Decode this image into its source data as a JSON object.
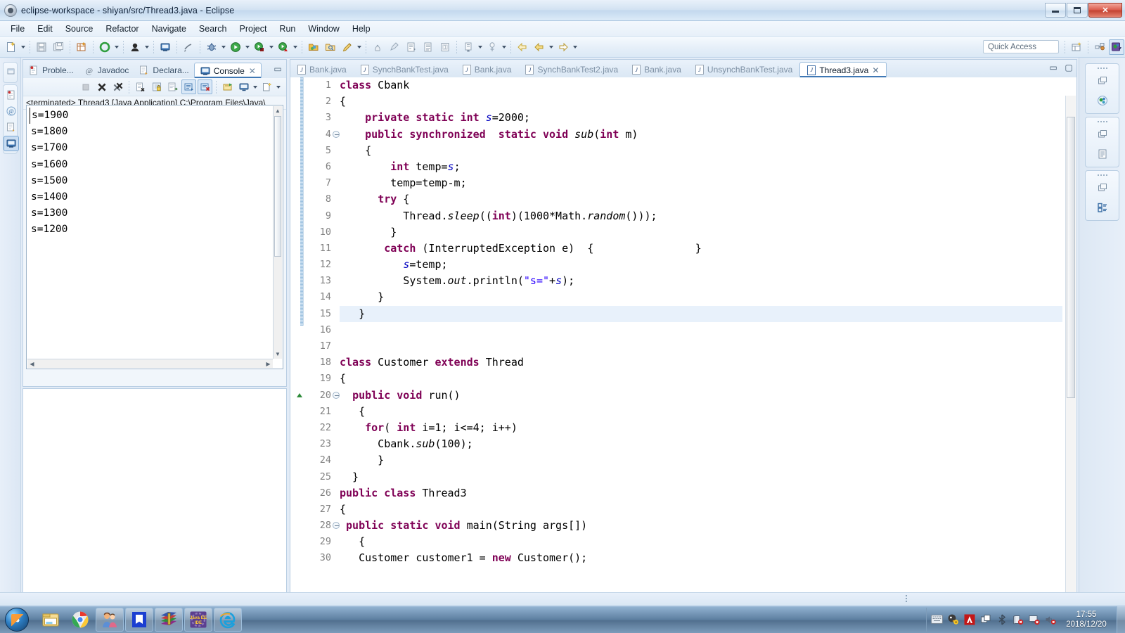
{
  "window": {
    "title": "eclipse-workspace - shiyan/src/Thread3.java - Eclipse",
    "icon": "eclipse-icon",
    "minimize_label": "",
    "maximize_label": "",
    "close_label": "✕"
  },
  "menubar": {
    "items": [
      "File",
      "Edit",
      "Source",
      "Refactor",
      "Navigate",
      "Search",
      "Project",
      "Run",
      "Window",
      "Help"
    ]
  },
  "toolbar": {
    "quick_access_placeholder": "Quick Access",
    "buttons": [
      {
        "name": "new-wizard-icon",
        "dropdown": true
      },
      {
        "name": "save-icon",
        "dropdown": false
      },
      {
        "name": "save-all-icon",
        "dropdown": false
      },
      {
        "name": "new-java-package-icon",
        "dropdown": false
      },
      {
        "name": "refresh-icon",
        "dropdown": true
      },
      {
        "name": "new-java-class-icon",
        "dropdown": true
      },
      {
        "name": "open-type-icon",
        "dropdown": false
      },
      {
        "name": "skip-breakpoints-icon",
        "dropdown": false
      },
      {
        "name": "debug-icon",
        "dropdown": true
      },
      {
        "name": "run-icon",
        "dropdown": true
      },
      {
        "name": "run-coverage-icon",
        "dropdown": true
      },
      {
        "name": "external-tools-icon",
        "dropdown": true
      },
      {
        "name": "open-task-icon",
        "dropdown": false
      },
      {
        "name": "search-folder-icon",
        "dropdown": false
      },
      {
        "name": "edit-pencil-icon",
        "dropdown": true
      },
      {
        "name": "profile-icon",
        "dropdown": false
      },
      {
        "name": "annotation-icon",
        "dropdown": false
      },
      {
        "name": "next-annotation-icon",
        "dropdown": false
      },
      {
        "name": "previous-edit-icon",
        "dropdown": false
      },
      {
        "name": "last-edit-location-icon",
        "dropdown": false
      },
      {
        "name": "toggle-mark-occurrences-icon",
        "dropdown": false
      },
      {
        "name": "back-icon",
        "dropdown": true
      },
      {
        "name": "forward-icon",
        "dropdown": true
      },
      {
        "name": "next-icon",
        "dropdown": true
      }
    ],
    "perspective_buttons": [
      {
        "name": "open-perspective-icon"
      },
      {
        "name": "java-perspective-icon"
      },
      {
        "name": "java-ee-perspective-icon"
      }
    ]
  },
  "fastview_left": {
    "items": [
      {
        "name": "minimize-icon"
      },
      {
        "name": "problems-view-icon"
      },
      {
        "name": "javadoc-view-icon"
      },
      {
        "name": "declaration-view-icon"
      },
      {
        "name": "console-view-icon",
        "active": true
      }
    ]
  },
  "console_panel": {
    "tabs": [
      {
        "label": "Proble...",
        "icon": "problems-icon",
        "active": false
      },
      {
        "label": "Javadoc",
        "icon": "javadoc-icon",
        "active": false
      },
      {
        "label": "Declara...",
        "icon": "declaration-icon",
        "active": false
      },
      {
        "label": "Console",
        "icon": "console-icon",
        "active": true,
        "close": "✕"
      }
    ],
    "minimize_glyph": "▭",
    "toolbar_buttons": [
      {
        "name": "terminate-disabled-icon",
        "toggled": false
      },
      {
        "name": "terminate-icon",
        "toggled": false
      },
      {
        "name": "remove-all-terminated-icon",
        "toggled": false
      },
      {
        "name": "clear-console-icon",
        "toggled": false
      },
      {
        "name": "lock-scroll-icon",
        "toggled": false
      },
      {
        "name": "word-wrap-icon",
        "toggled": false
      },
      {
        "name": "scroll-lock-icon",
        "toggled": true
      },
      {
        "name": "pin-console-icon",
        "toggled": true
      },
      {
        "name": "display-selected-console-icon",
        "toggled": false
      },
      {
        "name": "open-console-icon",
        "toggled": false
      },
      {
        "name": "new-console-view-icon",
        "toggled": false
      }
    ],
    "process_label": "<terminated> Thread3 [Java Application] C:\\Program Files\\Java\\",
    "output_lines": [
      "s=1900",
      "s=1800",
      "s=1700",
      "s=1600",
      "s=1500",
      "s=1400",
      "s=1300",
      "s=1200"
    ]
  },
  "editor": {
    "tabs": [
      {
        "label": "Bank.java",
        "active": false
      },
      {
        "label": "SynchBankTest.java",
        "active": false
      },
      {
        "label": "Bank.java",
        "active": false
      },
      {
        "label": "SynchBankTest2.java",
        "active": false
      },
      {
        "label": "Bank.java",
        "active": false
      },
      {
        "label": "UnsynchBankTest.java",
        "active": false
      },
      {
        "label": "Thread3.java",
        "active": true,
        "close": "✕"
      }
    ],
    "minimize_glyph": "▭",
    "maximize_glyph": "▢",
    "highlighted_line": 15,
    "folded_lines": [
      4,
      20,
      28
    ],
    "marker_lines": [
      20
    ],
    "lines": [
      {
        "n": 1,
        "text": "class Cbank"
      },
      {
        "n": 2,
        "text": "{"
      },
      {
        "n": 3,
        "text": "    private static int s=2000;"
      },
      {
        "n": 4,
        "text": "    public synchronized  static void sub(int m)"
      },
      {
        "n": 5,
        "text": "    {"
      },
      {
        "n": 6,
        "text": "        int temp=s;"
      },
      {
        "n": 7,
        "text": "        temp=temp-m;"
      },
      {
        "n": 8,
        "text": "      try {"
      },
      {
        "n": 9,
        "text": "          Thread.sleep((int)(1000*Math.random()));"
      },
      {
        "n": 10,
        "text": "        }"
      },
      {
        "n": 11,
        "text": "       catch (InterruptedException e)  {                }"
      },
      {
        "n": 12,
        "text": "          s=temp;"
      },
      {
        "n": 13,
        "text": "          System.out.println(\"s=\"+s);"
      },
      {
        "n": 14,
        "text": "      }"
      },
      {
        "n": 15,
        "text": "   }"
      },
      {
        "n": 16,
        "text": ""
      },
      {
        "n": 17,
        "text": ""
      },
      {
        "n": 18,
        "text": "class Customer extends Thread"
      },
      {
        "n": 19,
        "text": "{"
      },
      {
        "n": 20,
        "text": "  public void run()"
      },
      {
        "n": 21,
        "text": "   {"
      },
      {
        "n": 22,
        "text": "    for( int i=1; i<=4; i++)"
      },
      {
        "n": 23,
        "text": "      Cbank.sub(100);"
      },
      {
        "n": 24,
        "text": "      }"
      },
      {
        "n": 25,
        "text": "  }"
      },
      {
        "n": 26,
        "text": "public class Thread3"
      },
      {
        "n": 27,
        "text": "{"
      },
      {
        "n": 28,
        "text": " public static void main(String args[])"
      },
      {
        "n": 29,
        "text": "   {"
      },
      {
        "n": 30,
        "text": "   Customer customer1 = new Customer();"
      }
    ]
  },
  "fastview_right": {
    "groups": [
      [
        {
          "name": "restore-icon"
        },
        {
          "name": "java-perspective-icon"
        }
      ],
      [
        {
          "name": "restore-icon"
        },
        {
          "name": "outline-view-icon"
        }
      ],
      [
        {
          "name": "restore-icon"
        },
        {
          "name": "task-list-icon"
        }
      ]
    ]
  },
  "taskbar": {
    "start_label": "start-orb",
    "pinned": [
      {
        "name": "windows-explorer-icon"
      },
      {
        "name": "google-chrome-icon"
      }
    ],
    "running": [
      {
        "name": "qq-icon"
      },
      {
        "name": "wps-writer-icon"
      },
      {
        "name": "winrar-icon"
      },
      {
        "name": "eclipse-java-ee-ide-icon"
      },
      {
        "name": "internet-explorer-icon"
      }
    ],
    "tray": [
      {
        "name": "keyboard-layout-icon"
      },
      {
        "name": "sogou-input-icon"
      },
      {
        "name": "adobe-icon"
      },
      {
        "name": "window-switcher-icon"
      },
      {
        "name": "bluetooth-icon"
      },
      {
        "name": "network-disconnected-icon"
      },
      {
        "name": "display-icon"
      },
      {
        "name": "volume-muted-icon"
      }
    ],
    "clock_time": "17:55",
    "clock_date": "2018/12/20"
  },
  "colors": {
    "keyword": "#7f0055",
    "string": "#2a00ff",
    "field": "#0000c0",
    "line_number": "#808080",
    "selected_line": "#e8f1fb",
    "accent": "#3f78b5"
  }
}
